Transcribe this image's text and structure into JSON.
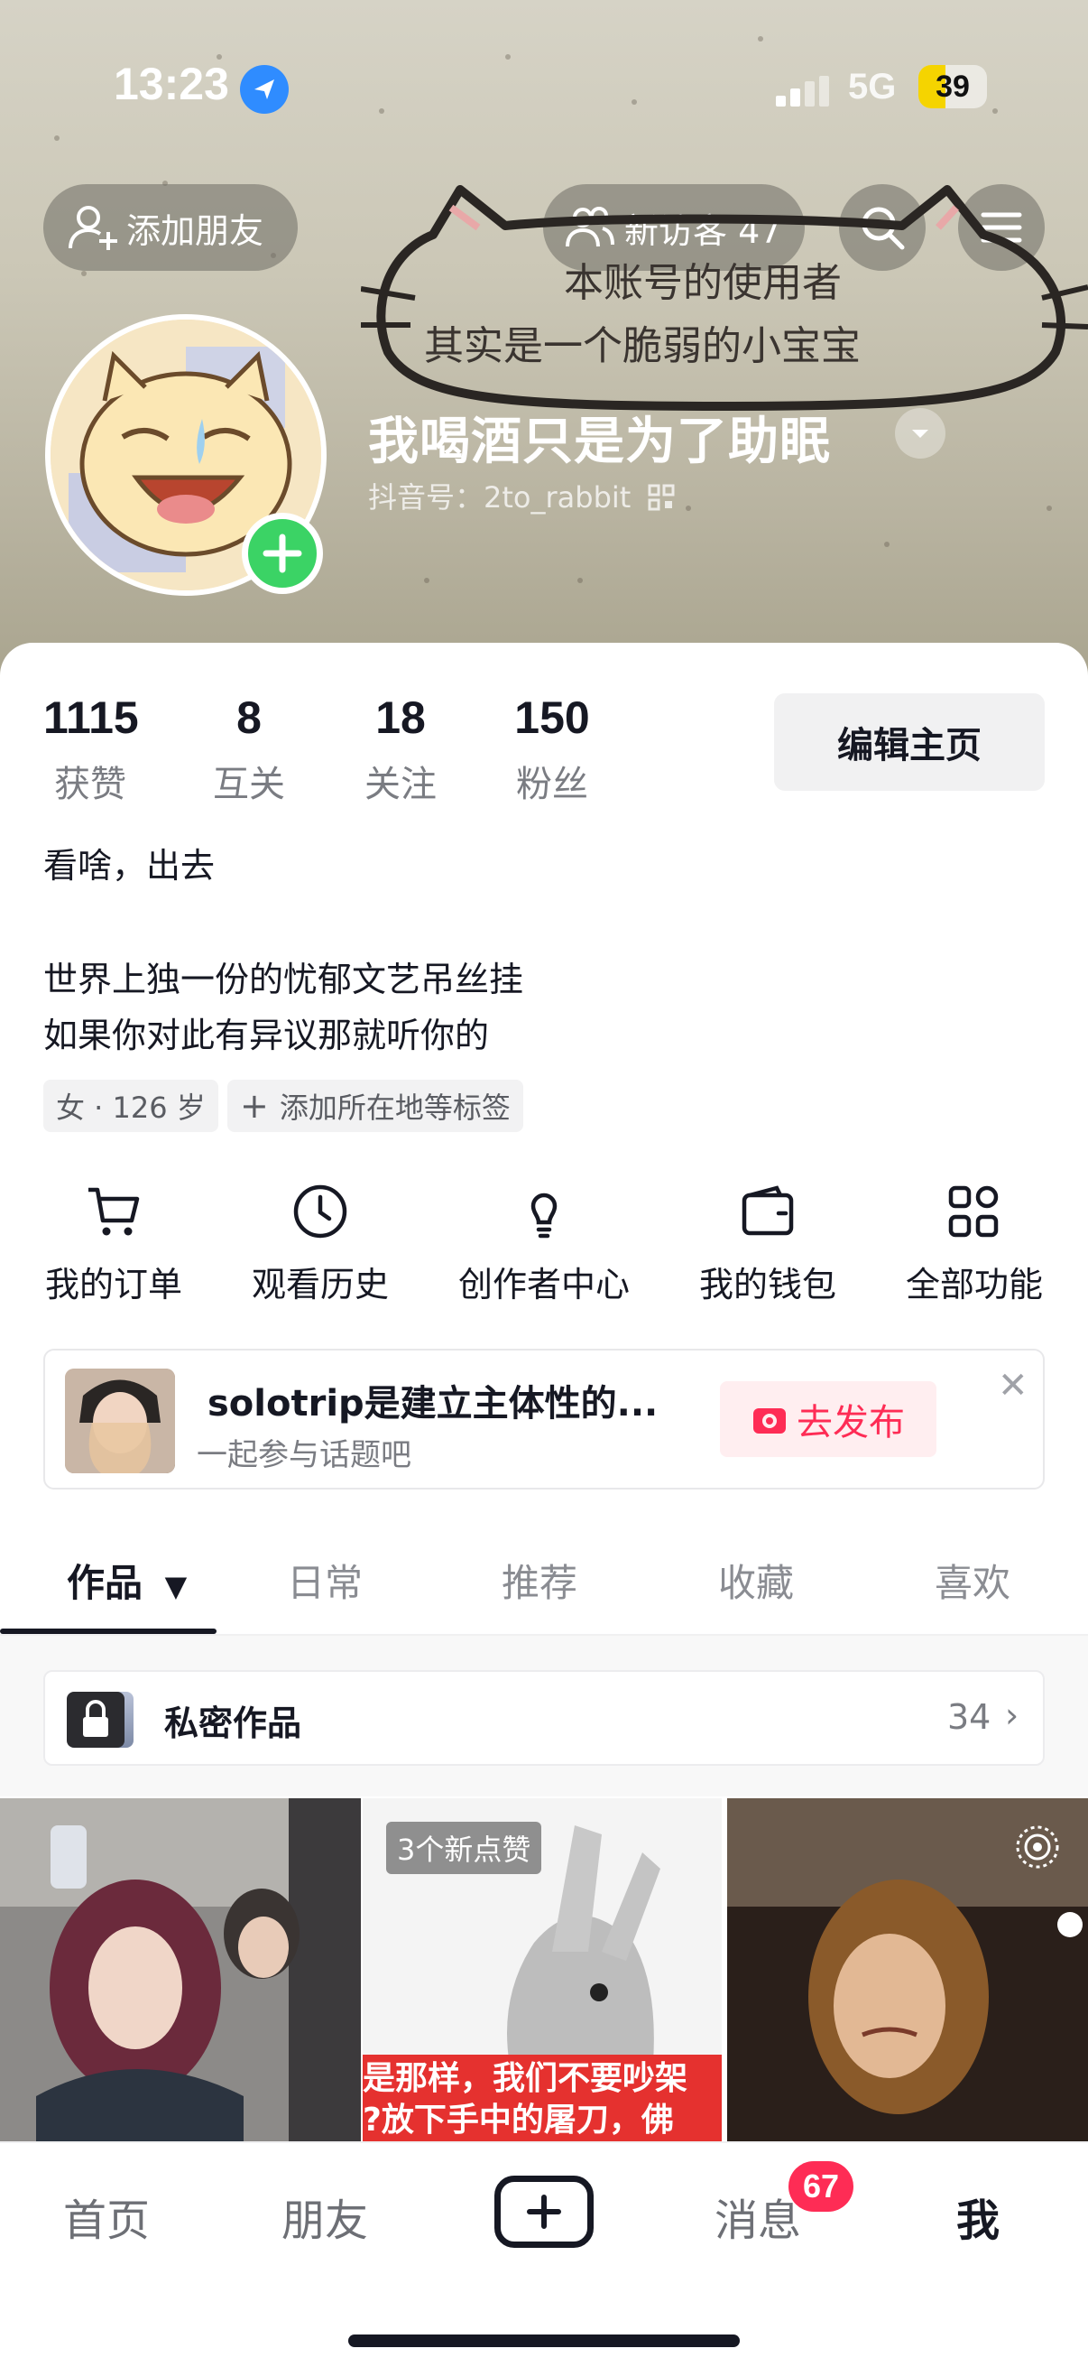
{
  "status_bar": {
    "time": "13:23",
    "network": "5G",
    "battery": "39",
    "battery_level": 0.39
  },
  "header": {
    "add_friend_label": "添加朋友",
    "visitors_label": "新访客 47",
    "doodle_line1": "本账号的使用者",
    "doodle_line2": "其实是一个脆弱的小宝宝",
    "nickname": "我喝酒只是为了助眠",
    "douyin_id": "抖音号：2to_rabbit"
  },
  "stats": [
    {
      "value": "1115",
      "label": "获赞"
    },
    {
      "value": "8",
      "label": "互关"
    },
    {
      "value": "18",
      "label": "关注"
    },
    {
      "value": "150",
      "label": "粉丝"
    }
  ],
  "edit_profile_label": "编辑主页",
  "bio": {
    "line1": "看啥，出去",
    "line2": "世界上独一份的忧郁文艺吊丝挂",
    "line3": "如果你对此有异议那就听你的"
  },
  "tags": {
    "gender_age": "女 · 126 岁",
    "add_location": "添加所在地等标签"
  },
  "functions": [
    {
      "label": "我的订单",
      "icon": "cart-icon"
    },
    {
      "label": "观看历史",
      "icon": "clock-icon"
    },
    {
      "label": "创作者中心",
      "icon": "lightbulb-icon"
    },
    {
      "label": "我的钱包",
      "icon": "wallet-icon"
    },
    {
      "label": "全部功能",
      "icon": "grid-icon"
    }
  ],
  "topic_card": {
    "title": "solotrip是建立主体性的...",
    "subtitle": "一起参与话题吧",
    "publish_label": "去发布"
  },
  "tabs": [
    "作品",
    "日常",
    "推荐",
    "收藏",
    "喜欢"
  ],
  "private_works": {
    "label": "私密作品",
    "count": "34"
  },
  "grid": {
    "likes_badge": "3个新点赞",
    "caption_line1": "是那样，我们不要吵架",
    "caption_line2": "?放下手中的屠刀，佛"
  },
  "bottom_nav": {
    "home": "首页",
    "friends": "朋友",
    "messages": "消息",
    "messages_badge": "67",
    "me": "我"
  },
  "colors": {
    "accent_red": "#fe2c55",
    "add_green": "#3bd365",
    "location_blue": "#2f8cff",
    "battery_yellow": "#f5d400"
  }
}
